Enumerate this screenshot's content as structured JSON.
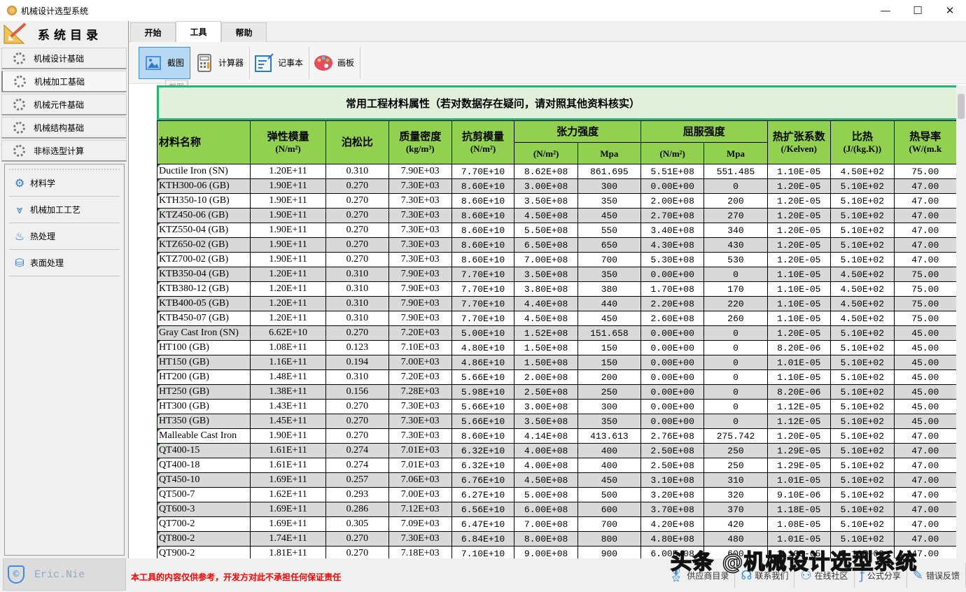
{
  "window": {
    "title": "机械设计选型系统",
    "controls": [
      "—",
      "☐",
      "✕"
    ]
  },
  "sidebar": {
    "title": "系统目录",
    "nav": [
      "机械设计基础",
      "机械加工基础",
      "机械元件基础",
      "机械结构基础",
      "非标选型计算"
    ],
    "active_nav": 1,
    "sub_items": [
      {
        "label": "材料学",
        "icon": "materials-icon"
      },
      {
        "label": "机械加工工艺",
        "icon": "machining-icon"
      },
      {
        "label": "热处理",
        "icon": "heat-treatment-icon"
      },
      {
        "label": "表面处理",
        "icon": "surface-treatment-icon"
      }
    ],
    "user": "Eric.Nie"
  },
  "tabs": [
    "开始",
    "工具",
    "帮助"
  ],
  "active_tab": 1,
  "ribbon": [
    {
      "label": "截图",
      "icon": "screenshot-icon"
    },
    {
      "label": "计算器",
      "icon": "calculator-icon"
    },
    {
      "label": "记事本",
      "icon": "notepad-icon"
    },
    {
      "label": "画板",
      "icon": "palette-icon"
    }
  ],
  "tooltip": "截图",
  "table": {
    "title": "常用工程材料属性（若对数据存在疑问，请对照其他资料核实）",
    "headers": {
      "name": "材料名称",
      "elastic": "弹性模量",
      "elastic_unit": "(N/m²)",
      "poisson": "泊松比",
      "density": "质量密度",
      "density_unit": "(kg/m³)",
      "shear": "抗剪模量",
      "shear_unit": "(N/m²)",
      "tensile": "张力强度",
      "yield": "屈服强度",
      "nm2": "(N/m²)",
      "mpa": "Mpa",
      "thermal_exp": "热扩张系数",
      "thermal_exp_unit": "(/Kelven)",
      "specific_heat": "比热",
      "specific_heat_unit": "(J/(kg.K))",
      "conductivity": "热导率",
      "conductivity_unit": "(W/(m.k"
    },
    "rows": [
      [
        "Ductile Iron (SN)",
        "1.20E+11",
        "0.310",
        "7.90E+03",
        "7.70E+10",
        "8.62E+08",
        "861.695",
        "5.51E+08",
        "551.485",
        "1.10E-05",
        "4.50E+02",
        "75.00"
      ],
      [
        "KTH300-06 (GB)",
        "1.90E+11",
        "0.270",
        "7.30E+03",
        "8.60E+10",
        "3.00E+08",
        "300",
        "0.00E+00",
        "0",
        "1.20E-05",
        "5.10E+02",
        "47.00"
      ],
      [
        "KTH350-10 (GB)",
        "1.90E+11",
        "0.270",
        "7.30E+03",
        "8.60E+10",
        "3.50E+08",
        "350",
        "2.00E+08",
        "200",
        "1.20E-05",
        "5.10E+02",
        "47.00"
      ],
      [
        "KTZ450-06 (GB)",
        "1.90E+11",
        "0.270",
        "7.30E+03",
        "8.60E+10",
        "4.50E+08",
        "450",
        "2.70E+08",
        "270",
        "1.20E-05",
        "5.10E+02",
        "47.00"
      ],
      [
        "KTZ550-04 (GB)",
        "1.90E+11",
        "0.270",
        "7.30E+03",
        "8.60E+10",
        "5.50E+08",
        "550",
        "3.40E+08",
        "340",
        "1.20E-05",
        "5.10E+02",
        "47.00"
      ],
      [
        "KTZ650-02 (GB)",
        "1.90E+11",
        "0.270",
        "7.30E+03",
        "8.60E+10",
        "6.50E+08",
        "650",
        "4.30E+08",
        "430",
        "1.20E-05",
        "5.10E+02",
        "47.00"
      ],
      [
        "KTZ700-02 (GB)",
        "1.90E+11",
        "0.270",
        "7.30E+03",
        "8.60E+10",
        "7.00E+08",
        "700",
        "5.30E+08",
        "530",
        "1.20E-05",
        "5.10E+02",
        "47.00"
      ],
      [
        "KTB350-04 (GB)",
        "1.20E+11",
        "0.310",
        "7.90E+03",
        "7.70E+10",
        "3.50E+08",
        "350",
        "0.00E+00",
        "0",
        "1.10E-05",
        "4.50E+02",
        "75.00"
      ],
      [
        "KTB380-12 (GB)",
        "1.20E+11",
        "0.310",
        "7.90E+03",
        "7.70E+10",
        "3.80E+08",
        "380",
        "1.70E+08",
        "170",
        "1.10E-05",
        "4.50E+02",
        "75.00"
      ],
      [
        "KTB400-05 (GB)",
        "1.20E+11",
        "0.310",
        "7.90E+03",
        "7.70E+10",
        "4.40E+08",
        "440",
        "2.20E+08",
        "220",
        "1.10E-05",
        "4.50E+02",
        "75.00"
      ],
      [
        "KTB450-07 (GB)",
        "1.20E+11",
        "0.310",
        "7.90E+03",
        "7.70E+10",
        "4.50E+08",
        "450",
        "2.60E+08",
        "260",
        "1.10E-05",
        "4.50E+02",
        "75.00"
      ],
      [
        "Gray Cast Iron (SN)",
        "6.62E+10",
        "0.270",
        "7.20E+03",
        "5.00E+10",
        "1.52E+08",
        "151.658",
        "0.00E+00",
        "0",
        "1.20E-05",
        "5.10E+02",
        "45.00"
      ],
      [
        "HT100 (GB)",
        "1.08E+11",
        "0.123",
        "7.10E+03",
        "4.80E+10",
        "1.50E+08",
        "150",
        "0.00E+00",
        "0",
        "8.20E-06",
        "5.10E+02",
        "45.00"
      ],
      [
        "HT150 (GB)",
        "1.16E+11",
        "0.194",
        "7.00E+03",
        "4.86E+10",
        "1.50E+08",
        "150",
        "0.00E+00",
        "0",
        "1.01E-05",
        "5.10E+02",
        "45.00"
      ],
      [
        "HT200 (GB)",
        "1.48E+11",
        "0.310",
        "7.20E+03",
        "5.66E+10",
        "2.00E+08",
        "200",
        "0.00E+00",
        "0",
        "1.10E-05",
        "5.10E+02",
        "45.00"
      ],
      [
        "HT250 (GB)",
        "1.38E+11",
        "0.156",
        "7.28E+03",
        "5.98E+10",
        "2.50E+08",
        "250",
        "0.00E+00",
        "0",
        "8.20E-06",
        "5.10E+02",
        "45.00"
      ],
      [
        "HT300 (GB)",
        "1.43E+11",
        "0.270",
        "7.30E+03",
        "5.66E+10",
        "3.00E+08",
        "300",
        "0.00E+00",
        "0",
        "1.12E-05",
        "5.10E+02",
        "45.00"
      ],
      [
        "HT350 (GB)",
        "1.45E+11",
        "0.270",
        "7.30E+03",
        "5.66E+10",
        "3.50E+08",
        "350",
        "0.00E+00",
        "0",
        "1.12E-05",
        "5.10E+02",
        "45.00"
      ],
      [
        "Malleable Cast Iron",
        "1.90E+11",
        "0.270",
        "7.30E+03",
        "8.60E+10",
        "4.14E+08",
        "413.613",
        "2.76E+08",
        "275.742",
        "1.20E-05",
        "5.10E+02",
        "47.00"
      ],
      [
        "QT400-15",
        "1.61E+11",
        "0.274",
        "7.01E+03",
        "6.32E+10",
        "4.00E+08",
        "400",
        "2.50E+08",
        "250",
        "1.29E-05",
        "5.10E+02",
        "47.00"
      ],
      [
        "QT400-18",
        "1.61E+11",
        "0.274",
        "7.01E+03",
        "6.32E+10",
        "4.00E+08",
        "400",
        "2.50E+08",
        "250",
        "1.29E-05",
        "5.10E+02",
        "47.00"
      ],
      [
        "QT450-10",
        "1.69E+11",
        "0.257",
        "7.06E+03",
        "6.76E+10",
        "4.50E+08",
        "450",
        "3.10E+08",
        "310",
        "1.01E-05",
        "5.10E+02",
        "47.00"
      ],
      [
        "QT500-7",
        "1.62E+11",
        "0.293",
        "7.00E+03",
        "6.27E+10",
        "5.00E+08",
        "500",
        "3.20E+08",
        "320",
        "9.10E-06",
        "5.10E+02",
        "47.00"
      ],
      [
        "QT600-3",
        "1.69E+11",
        "0.286",
        "7.12E+03",
        "6.56E+10",
        "6.00E+08",
        "600",
        "3.70E+08",
        "370",
        "1.18E-05",
        "5.10E+02",
        "47.00"
      ],
      [
        "QT700-2",
        "1.69E+11",
        "0.305",
        "7.09E+03",
        "6.47E+10",
        "7.00E+08",
        "700",
        "4.20E+08",
        "420",
        "1.08E-05",
        "5.10E+02",
        "47.00"
      ],
      [
        "QT800-2",
        "1.74E+11",
        "0.270",
        "7.30E+03",
        "6.84E+10",
        "8.00E+08",
        "800",
        "4.80E+08",
        "480",
        "1.01E-05",
        "5.10E+02",
        "47.00"
      ],
      [
        "QT900-2",
        "1.81E+11",
        "0.270",
        "7.18E+03",
        "7.10E+10",
        "9.00E+08",
        "900",
        "6.00E+08",
        "600",
        "1.10E-05",
        "5.10E+02",
        "47.00"
      ]
    ]
  },
  "footer": {
    "disclaimer": "本工具的内容仅供参考，开发方对此不承担任何保证责任",
    "links": [
      {
        "label": "供应商目录",
        "icon": "award-icon"
      },
      {
        "label": "联系我们",
        "icon": "headset-icon"
      },
      {
        "label": "在线社区",
        "icon": "community-icon"
      },
      {
        "label": "公式分享",
        "icon": "formula-icon"
      },
      {
        "label": "错误反馈",
        "icon": "feedback-icon"
      }
    ]
  },
  "watermark": "头条 @机械设计选型系统",
  "colors": {
    "header_green": "#92d050",
    "title_bg": "#e2efda",
    "title_border": "#22b573",
    "alt_row": "#d9d9d9",
    "disclaimer": "#ff0000",
    "accent": "#3a8ddb"
  }
}
